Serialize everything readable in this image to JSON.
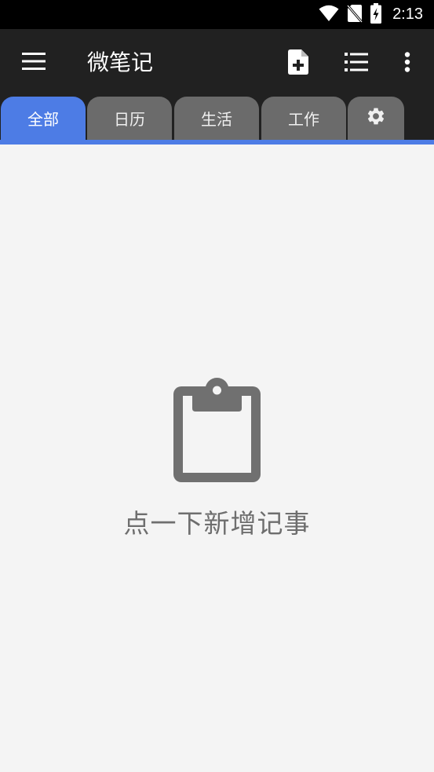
{
  "status_bar": {
    "time": "2:13",
    "icons": [
      "wifi-icon",
      "no-sim-icon",
      "battery-charging-icon"
    ]
  },
  "app_bar": {
    "title": "微笔记",
    "actions": [
      "new-note-icon",
      "list-view-icon",
      "more-vert-icon"
    ]
  },
  "tabs": [
    {
      "label": "全部",
      "active": true
    },
    {
      "label": "日历",
      "active": false
    },
    {
      "label": "生活",
      "active": false
    },
    {
      "label": "工作",
      "active": false
    }
  ],
  "tab_settings_icon": "gear-icon",
  "colors": {
    "app_bar": "#212121",
    "accent": "#4d7ce5",
    "tab_inactive": "#6b6b6b",
    "background": "#f4f4f4",
    "empty_text": "#6e6e6e"
  },
  "empty_state": {
    "icon": "clipboard-icon",
    "text": "点一下新增记事"
  }
}
